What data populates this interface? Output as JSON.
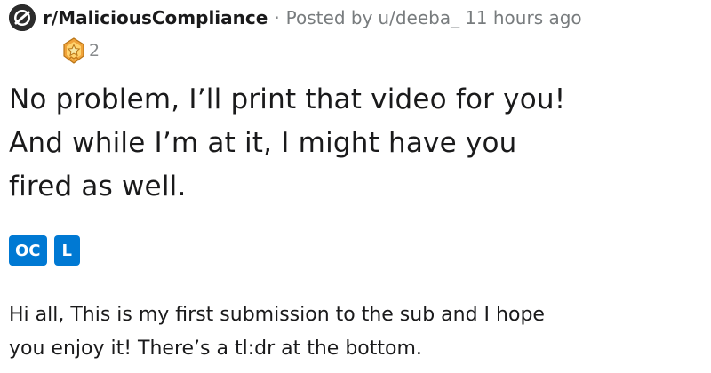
{
  "post": {
    "subreddit": "r/MaliciousCompliance",
    "separator": "·",
    "posted_by_label": "Posted by",
    "author": "u/deeba_",
    "time_ago": "11 hours ago",
    "award_icon": "award-badge-icon",
    "award_count": "2",
    "title_line1": "No problem, I’ll print that video for you!",
    "title_line2": "And while I’m at it, I might have you",
    "title_line3": "fired as well.",
    "flairs": [
      "OC",
      "L"
    ],
    "body_line1": "Hi all, This is my first submission to the sub and I hope",
    "body_line2": "you enjoy it! There’s a tl:dr at the bottom."
  },
  "colors": {
    "flair_background": "#0079d3",
    "meta_text": "#787c7e",
    "title_text": "#1a1a1b"
  }
}
